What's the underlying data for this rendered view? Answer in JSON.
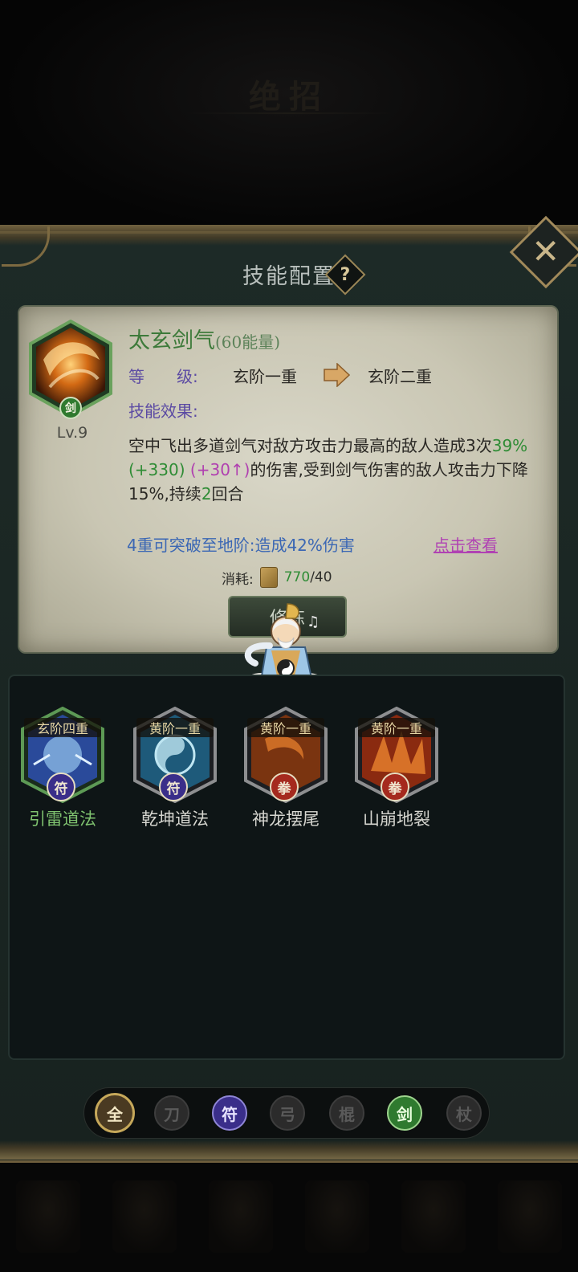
{
  "background": {
    "title": "绝招"
  },
  "modal": {
    "title": "技能配置",
    "help_icon": "?",
    "close_icon": "✕"
  },
  "skill": {
    "name": "太玄剑气",
    "energy": "(60能量)",
    "level": "Lv.9",
    "type_badge": "剑",
    "grade_label": "等　　级:",
    "grade_current": "玄阶一重",
    "grade_next": "玄阶二重",
    "effect_label": "技能效果:",
    "effect_pre": "空中飞出多道剑气对敌方攻击力最高的敌人造成3次",
    "effect_pct": "39%(+330)",
    "effect_bonus": "(+30↑)",
    "effect_post": "的伤害,受到剑气伤害的敌人攻击力下降15%,持续",
    "effect_turns": "2",
    "effect_end": "回合",
    "break_text": "4重可突破至地阶:造成42%伤害",
    "view_link": "点击查看",
    "cost_label": "消耗:",
    "cost_current": "770",
    "cost_required": "/40",
    "upgrade_label": "修炼"
  },
  "skill_list": [
    {
      "rank": "玄阶四重",
      "name": "引雷道法",
      "type": "符",
      "active": true,
      "color": "#2a4a9a"
    },
    {
      "rank": "黄阶一重",
      "name": "乾坤道法",
      "type": "符",
      "active": false,
      "color": "#1e5a7a"
    },
    {
      "rank": "黄阶一重",
      "name": "神龙摆尾",
      "type": "拳",
      "active": false,
      "color": "#7a3410"
    },
    {
      "rank": "黄阶一重",
      "name": "山崩地裂",
      "type": "拳",
      "active": false,
      "color": "#8a2a10"
    }
  ],
  "filters": [
    {
      "label": "全",
      "selected": true
    },
    {
      "label": "刀",
      "selected": false
    },
    {
      "label": "符",
      "selected": false
    },
    {
      "label": "弓",
      "selected": false
    },
    {
      "label": "棍",
      "selected": false
    },
    {
      "label": "剑",
      "selected": false
    },
    {
      "label": "杖",
      "selected": false
    }
  ]
}
